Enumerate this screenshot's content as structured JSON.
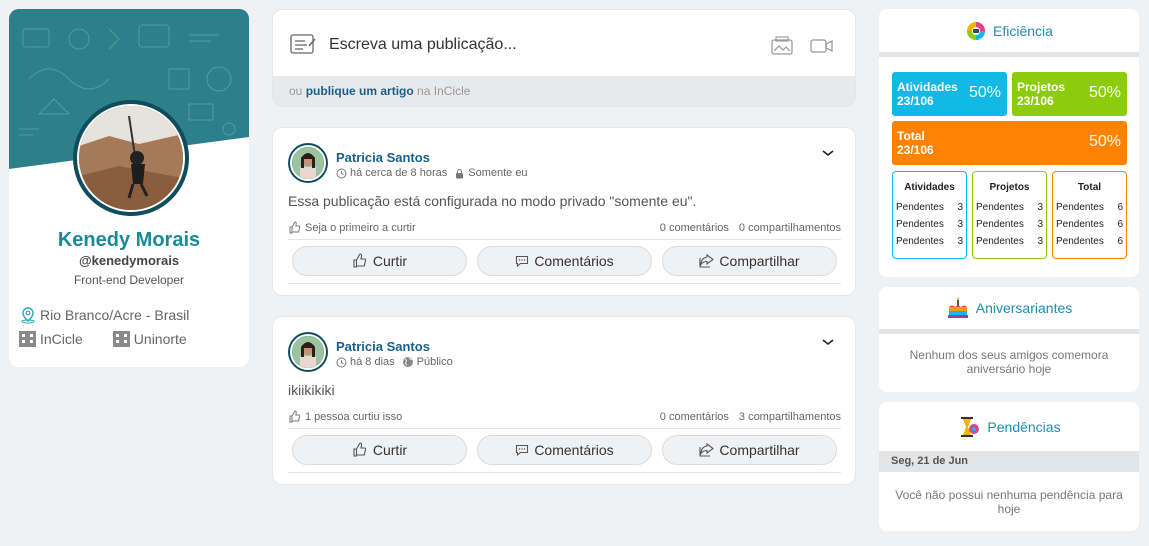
{
  "profile": {
    "name": "Kenedy Morais",
    "username": "@kenedymorais",
    "role": "Front-end Developer",
    "location": "Rio Branco/Acre - Brasil",
    "orgs": [
      "InCicle",
      "Uninorte"
    ]
  },
  "composer": {
    "placeholder": "Escreva uma publicação...",
    "footer_prefix": "ou",
    "footer_link": "publique um artigo",
    "footer_suffix": "na InCicle"
  },
  "posts": [
    {
      "author": "Patricia Santos",
      "time": "há cerca de 8 horas",
      "privacy": "Somente eu",
      "text": "Essa publicação está configurada no modo privado \"somente eu\".",
      "likes": "Seja o primeiro a curtir",
      "comments": "0 comentários",
      "shares": "0 compartilhamentos"
    },
    {
      "author": "Patricia Santos",
      "time": "há 8 dias",
      "privacy": "Público",
      "text": "ikiikikiki",
      "likes": "1 pessoa curtiu isso",
      "comments": "0 comentários",
      "shares": "3 compartilhamentos"
    }
  ],
  "post_actions": {
    "like": "Curtir",
    "comment": "Comentários",
    "share": "Compartilhar"
  },
  "efficiency": {
    "title": "Eficiência",
    "tiles": [
      {
        "label": "Atividades",
        "ratio": "23/106",
        "percent": "50%",
        "color": "#12b8e6"
      },
      {
        "label": "Projetos",
        "ratio": "23/106",
        "percent": "50%",
        "color": "#8ccc0c"
      },
      {
        "label": "Total",
        "ratio": "23/106",
        "percent": "50%",
        "color": "#ff8200"
      }
    ],
    "boxes": [
      {
        "title": "Atividades",
        "rows": [
          {
            "label": "Pendentes",
            "value": "3"
          },
          {
            "label": "Pendentes",
            "value": "3"
          },
          {
            "label": "Pendentes",
            "value": "3"
          }
        ]
      },
      {
        "title": "Projetos",
        "rows": [
          {
            "label": "Pendentes",
            "value": "3"
          },
          {
            "label": "Pendentes",
            "value": "3"
          },
          {
            "label": "Pendentes",
            "value": "3"
          }
        ]
      },
      {
        "title": "Total",
        "rows": [
          {
            "label": "Pendentes",
            "value": "6"
          },
          {
            "label": "Pendentes",
            "value": "6"
          },
          {
            "label": "Pendentes",
            "value": "6"
          }
        ]
      }
    ]
  },
  "birthdays": {
    "title": "Aniversariantes",
    "empty": "Nenhum dos seus amigos comemora aniversário hoje"
  },
  "pending": {
    "title": "Pendências",
    "date": "Seg, 21 de Jun",
    "empty": "Você não possui nenhuma pendência para hoje"
  },
  "icons": {
    "location": "map-pin-icon",
    "org": "building-icon",
    "time": "clock-icon",
    "private": "lock-icon",
    "public": "globe-icon",
    "like": "thumbs-up-icon",
    "comment": "comment-icon",
    "share": "share-icon"
  },
  "colors": {
    "brand": "#1a8a99",
    "link": "#1a5f8a",
    "accent_blue": "#12b8e6",
    "accent_green": "#8ccc0c",
    "accent_orange": "#ff8200"
  }
}
